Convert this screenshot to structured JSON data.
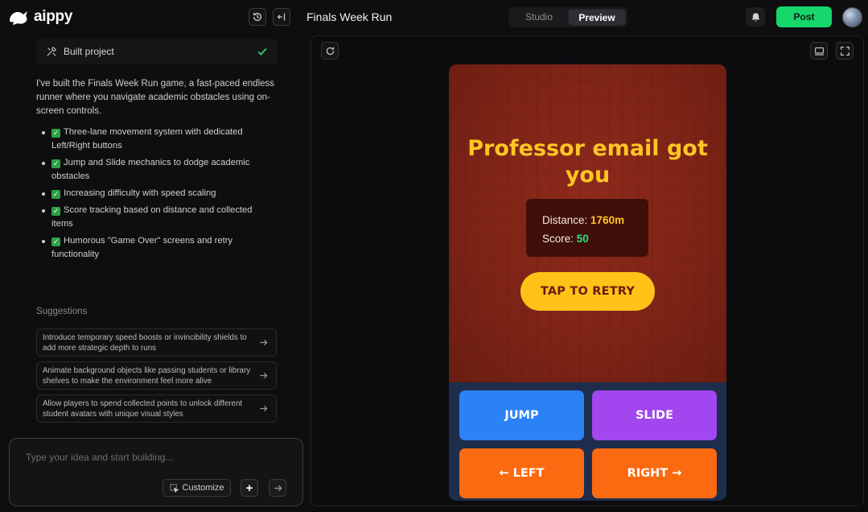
{
  "app": {
    "brand": "aippy",
    "project_title": "Finals Week Run",
    "view_tabs": [
      {
        "label": "Studio",
        "active": false
      },
      {
        "label": "Preview",
        "active": true
      }
    ],
    "post_label": "Post",
    "accent_color": "#17d66b"
  },
  "icons": {
    "history": "history-icon",
    "collapse": "collapse-panel-icon",
    "bell": "bell-icon",
    "refresh": "refresh-icon",
    "desktop": "desktop-view-icon",
    "fullscreen": "fullscreen-icon",
    "tools": "tools-icon",
    "check": "check-icon"
  },
  "chat": {
    "status_label": "Built project",
    "intro": "I've built the Finals Week Run game, a fast-paced endless runner where you navigate academic obstacles using on-screen controls.",
    "features": [
      "Three-lane movement system with dedicated Left/Right buttons",
      "Jump and Slide mechanics to dodge academic obstacles",
      "Increasing difficulty with speed scaling",
      "Score tracking based on distance and collected items",
      "Humorous \"Game Over\" screens and retry functionality"
    ],
    "suggestions_heading": "Suggestions",
    "suggestions": [
      "Introduce temporary speed boosts or invincibility shields to add more strategic depth to runs",
      "Animate background objects like passing students or library shelves to make the environment feel more alive",
      "Allow players to spend collected points to unlock different student avatars with unique visual styles"
    ],
    "composer": {
      "placeholder": "Type your idea and start building...",
      "customize_label": "Customize",
      "plus_label": "+"
    }
  },
  "game": {
    "game_over_title": "Professor email got you",
    "distance_label": "Distance:",
    "distance_value": "1760m",
    "score_label": "Score:",
    "score_value": "50",
    "retry_label": "TAP TO RETRY",
    "controls": {
      "jump": "JUMP",
      "slide": "SLIDE",
      "left": "← LEFT",
      "right": "RIGHT →"
    }
  }
}
